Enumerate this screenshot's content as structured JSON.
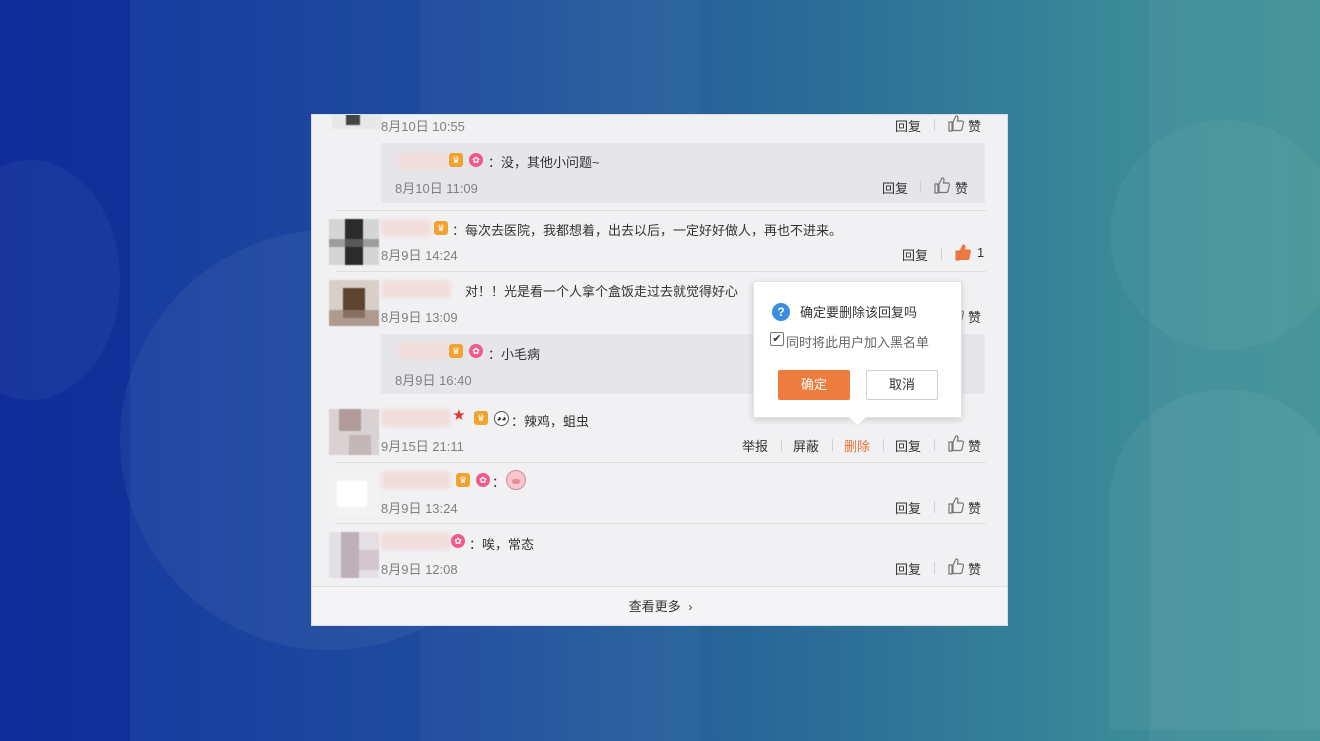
{
  "comments": [
    {
      "time": "8月10日 10:55",
      "actions": {
        "reply": "回复",
        "like": "赞"
      }
    },
    {
      "text": "：没，其他小问题~",
      "time": "8月10日 11:09",
      "actions": {
        "reply": "回复",
        "like": "赞"
      }
    },
    {
      "text": "：每次去医院，我都想着，出去以后，一定好好做人，再也不进来。",
      "time": "8月9日 14:24",
      "actions": {
        "reply": "回复",
        "like": "1"
      },
      "liked": true
    },
    {
      "text": "对！！光是看一个人拿个盒饭走过去就觉得好心",
      "time": "8月9日 13:09",
      "actions": {
        "like": "赞"
      }
    },
    {
      "text": "：小毛病",
      "time": "8月9日 16:40"
    },
    {
      "text": "：辣鸡，蛆虫",
      "time": "9月15日 21:11",
      "actions": {
        "report": "举报",
        "block": "屏蔽",
        "delete": "删除",
        "reply": "回复",
        "like": "赞"
      }
    },
    {
      "text": "：",
      "time": "8月9日 13:24",
      "actions": {
        "reply": "回复",
        "like": "赞"
      }
    },
    {
      "text": "：唉，常态",
      "time": "8月9日 12:08",
      "actions": {
        "reply": "回复",
        "like": "赞"
      }
    }
  ],
  "more_label": "查看更多",
  "popup": {
    "title": "确定要删除该回复吗",
    "checkbox_label": "同时将此用户加入黑名单",
    "checked": true,
    "confirm": "确定",
    "cancel": "取消"
  },
  "colors": {
    "accent": "#ee7c3e",
    "delete": "#e8733b",
    "liked": "#e8733b"
  }
}
